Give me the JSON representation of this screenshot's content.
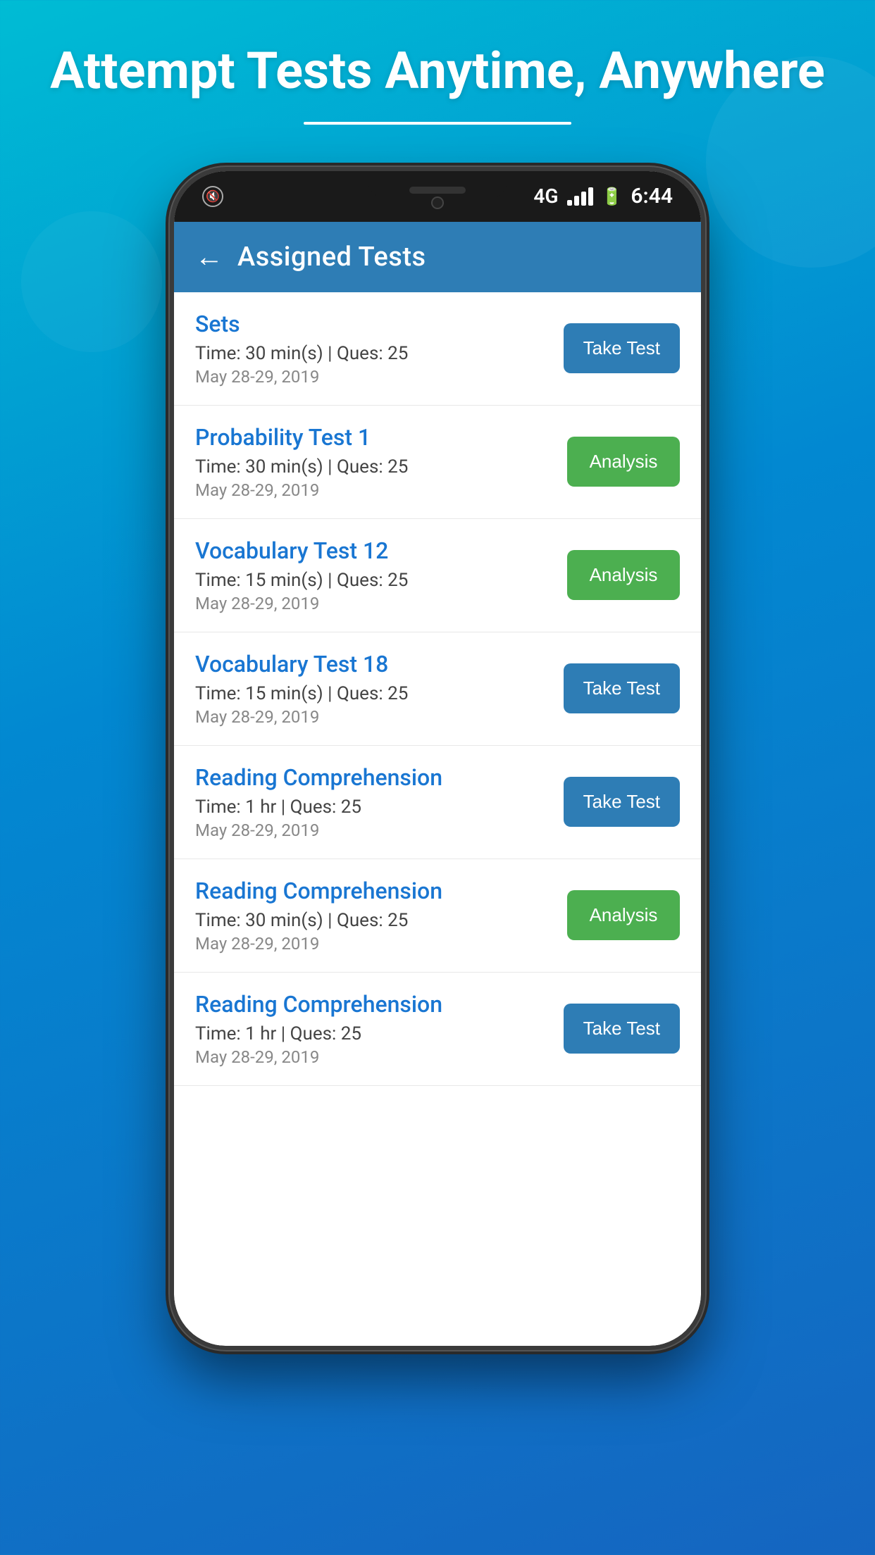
{
  "hero": {
    "title": "Attempt Tests Anytime, Anywhere"
  },
  "status_bar": {
    "time": "6:44",
    "network": "4G"
  },
  "header": {
    "title": "Assigned Tests",
    "back_label": "←"
  },
  "tests": [
    {
      "name": "Sets",
      "time": "Time: 30 min(s) | Ques: 25",
      "date": "May 28-29, 2019",
      "button_type": "take",
      "button_label": "Take Test"
    },
    {
      "name": "Probability Test 1",
      "time": "Time: 30 min(s) | Ques: 25",
      "date": "May 28-29, 2019",
      "button_type": "analysis",
      "button_label": "Analysis"
    },
    {
      "name": "Vocabulary Test 12",
      "time": "Time: 15 min(s) | Ques: 25",
      "date": "May 28-29, 2019",
      "button_type": "analysis",
      "button_label": "Analysis"
    },
    {
      "name": "Vocabulary Test 18",
      "time": "Time: 15 min(s) | Ques: 25",
      "date": "May 28-29, 2019",
      "button_type": "take",
      "button_label": "Take Test"
    },
    {
      "name": "Reading Comprehension",
      "time": "Time: 1 hr | Ques: 25",
      "date": "May 28-29, 2019",
      "button_type": "take",
      "button_label": "Take Test"
    },
    {
      "name": "Reading Comprehension",
      "time": "Time: 30 min(s) | Ques: 25",
      "date": "May 28-29, 2019",
      "button_type": "analysis",
      "button_label": "Analysis"
    },
    {
      "name": "Reading Comprehension",
      "time": "Time: 1 hr | Ques: 25",
      "date": "May 28-29, 2019",
      "button_type": "take",
      "button_label": "Take Test"
    }
  ]
}
